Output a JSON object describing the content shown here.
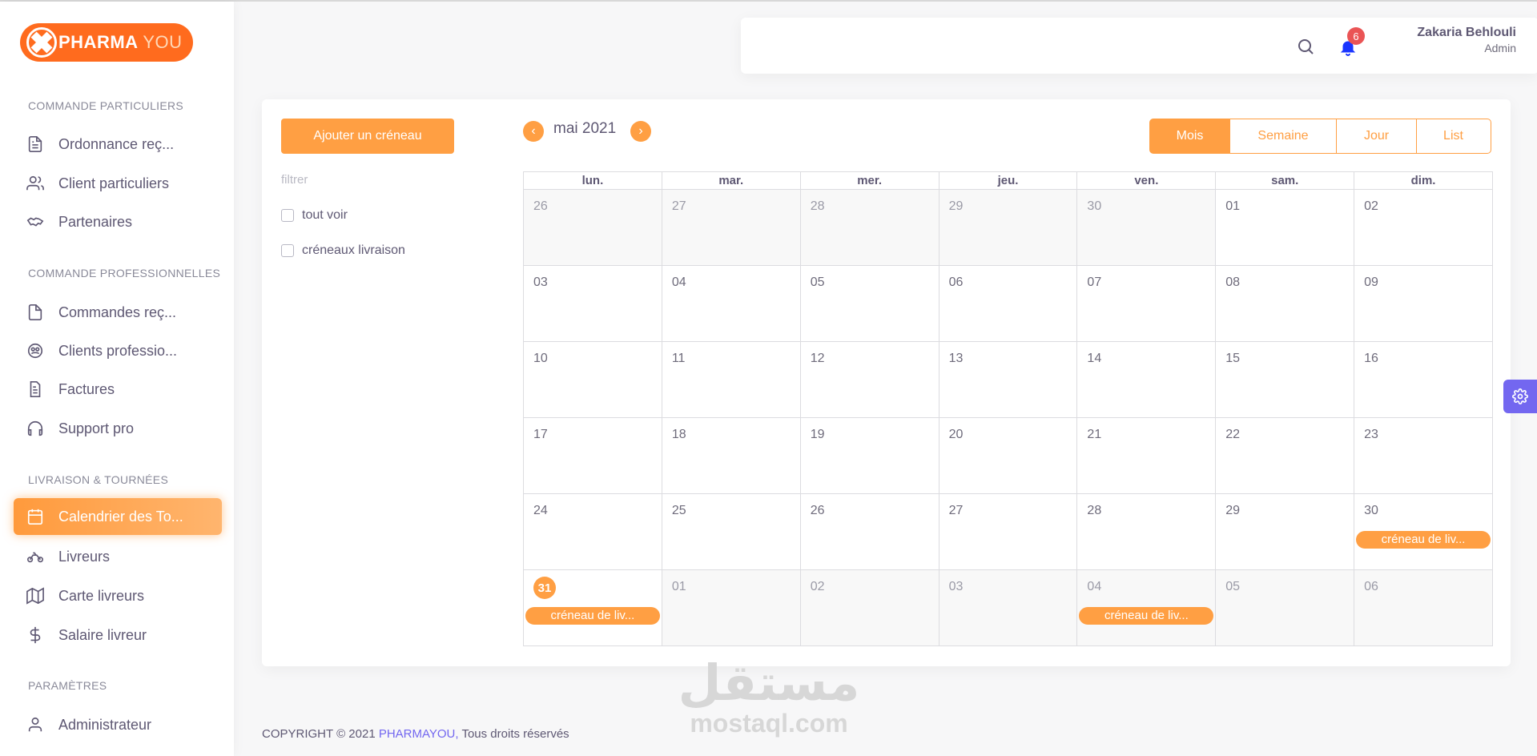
{
  "brand": {
    "logo_main": "PHARMA",
    "logo_accent": "YOU"
  },
  "sidebar": {
    "sections": [
      {
        "title": "COMMANDE PARTICULIERS"
      },
      {
        "title": "COMMANDE PROFESSIONNELLES"
      },
      {
        "title": "LIVRAISON & TOURNÉES"
      },
      {
        "title": "PARAMÈTRES"
      }
    ],
    "items": [
      {
        "label": "Ordonnance reç...",
        "icon": "file-text-icon"
      },
      {
        "label": "Client particuliers",
        "icon": "users-icon"
      },
      {
        "label": "Partenaires",
        "icon": "handshake-icon"
      },
      {
        "label": "Commandes reç...",
        "icon": "file-icon"
      },
      {
        "label": "Clients professio...",
        "icon": "group-icon"
      },
      {
        "label": "Factures",
        "icon": "invoice-icon"
      },
      {
        "label": "Support pro",
        "icon": "headphones-icon"
      },
      {
        "label": "Calendrier des To...",
        "icon": "calendar-icon",
        "active": true
      },
      {
        "label": "Livreurs",
        "icon": "motorcycle-icon"
      },
      {
        "label": "Carte livreurs",
        "icon": "map-icon"
      },
      {
        "label": "Salaire livreur",
        "icon": "dollar-icon"
      },
      {
        "label": "Administrateur",
        "icon": "user-icon"
      }
    ]
  },
  "header": {
    "notification_count": "6",
    "user_name": "Zakaria Behlouli",
    "user_role": "Admin"
  },
  "calendar": {
    "add_button": "Ajouter un créneau",
    "filter_label": "filtrer",
    "filters": [
      "tout voir",
      "créneaux livraison"
    ],
    "month_title": "mai 2021",
    "prev_icon": "chevron-left-icon",
    "next_icon": "chevron-right-icon",
    "views": [
      "Mois",
      "Semaine",
      "Jour",
      "List"
    ],
    "active_view": "Mois",
    "weekdays": [
      "lun.",
      "mar.",
      "mer.",
      "jeu.",
      "ven.",
      "sam.",
      "dim."
    ],
    "weeks": [
      [
        {
          "d": "26",
          "other": true
        },
        {
          "d": "27",
          "other": true
        },
        {
          "d": "28",
          "other": true
        },
        {
          "d": "29",
          "other": true
        },
        {
          "d": "30",
          "other": true
        },
        {
          "d": "01"
        },
        {
          "d": "02"
        }
      ],
      [
        {
          "d": "03"
        },
        {
          "d": "04"
        },
        {
          "d": "05"
        },
        {
          "d": "06"
        },
        {
          "d": "07"
        },
        {
          "d": "08"
        },
        {
          "d": "09"
        }
      ],
      [
        {
          "d": "10"
        },
        {
          "d": "11"
        },
        {
          "d": "12"
        },
        {
          "d": "13"
        },
        {
          "d": "14"
        },
        {
          "d": "15"
        },
        {
          "d": "16"
        }
      ],
      [
        {
          "d": "17"
        },
        {
          "d": "18"
        },
        {
          "d": "19"
        },
        {
          "d": "20"
        },
        {
          "d": "21"
        },
        {
          "d": "22"
        },
        {
          "d": "23"
        }
      ],
      [
        {
          "d": "24"
        },
        {
          "d": "25"
        },
        {
          "d": "26"
        },
        {
          "d": "27"
        },
        {
          "d": "28"
        },
        {
          "d": "29"
        },
        {
          "d": "30",
          "event": "créneau de liv..."
        }
      ],
      [
        {
          "d": "31",
          "today": true,
          "event": "créneau de liv..."
        },
        {
          "d": "01",
          "other": true
        },
        {
          "d": "02",
          "other": true
        },
        {
          "d": "03",
          "other": true
        },
        {
          "d": "04",
          "other": true,
          "event": "créneau de liv..."
        },
        {
          "d": "05",
          "other": true
        },
        {
          "d": "06",
          "other": true
        }
      ]
    ]
  },
  "footer": {
    "prefix": "COPYRIGHT © 2021 ",
    "brand": "PHARMAYOU,",
    "suffix": " Tous droits réservés"
  },
  "watermark": {
    "arabic": "مستقل",
    "latin": "mostaql.com"
  },
  "colors": {
    "accent": "#ff9f43",
    "logo": "#ff6b1e",
    "purple": "#7367f0",
    "badge": "#ea5455"
  }
}
